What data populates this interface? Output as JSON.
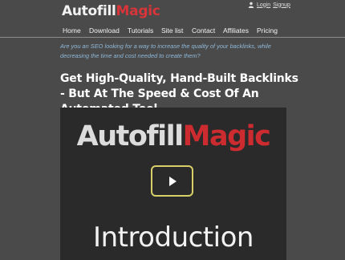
{
  "logo": {
    "part1": "Autofill",
    "part2": "Magic"
  },
  "auth": {
    "login": "Login",
    "signup": "Signup"
  },
  "nav": {
    "items": [
      "Home",
      "Download",
      "Tutorials",
      "Site list",
      "Contact",
      "Affiliates",
      "Pricing"
    ]
  },
  "intro": "Are you an SEO looking for a way to increase the quality of your backlinks, while decreasing the time and cost needed to create them?",
  "headline": "Get High-Quality, Hand-Built Backlinks - But At The Speed & Cost Of An Automated Tool",
  "video": {
    "logo_part1": "Autofill",
    "logo_part2": "Magic",
    "title": "Introduction",
    "play_icon": "play-icon"
  },
  "colors": {
    "background": "#4a4a4a",
    "brand_red": "#d8353a",
    "intro_text": "#8fb8d8",
    "play_border": "#d9cf68"
  }
}
